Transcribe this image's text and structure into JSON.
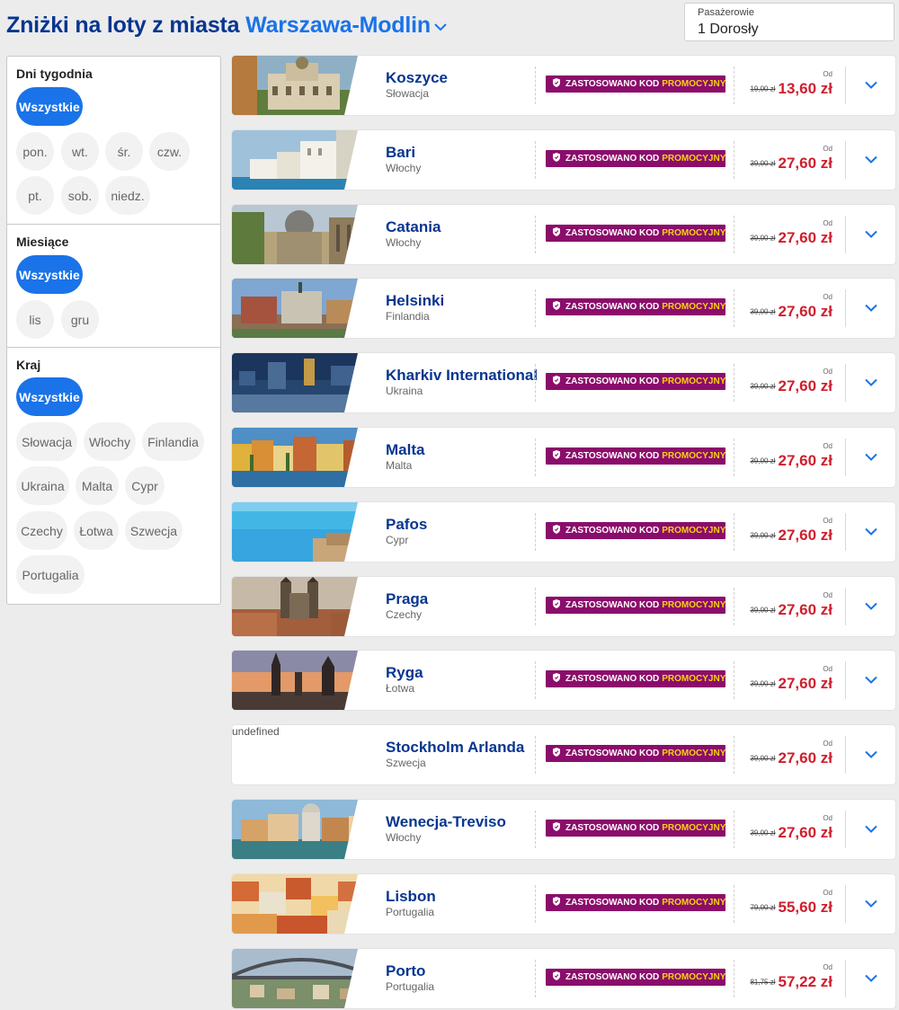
{
  "header": {
    "title_prefix": "Zniżki na loty z miasta",
    "city": "Warszawa-Modlin"
  },
  "passengers": {
    "label": "Pasażerowie",
    "value": "1 Dorosły"
  },
  "filters": {
    "days": {
      "title": "Dni tygodnia",
      "options": [
        "Wszystkie",
        "pon.",
        "wt.",
        "śr.",
        "czw.",
        "pt.",
        "sob.",
        "niedz."
      ],
      "selected": "Wszystkie"
    },
    "months": {
      "title": "Miesiące",
      "options": [
        "Wszystkie",
        "lis",
        "gru"
      ],
      "selected": "Wszystkie"
    },
    "country": {
      "title": "Kraj",
      "options": [
        "Wszystkie",
        "Słowacja",
        "Włochy",
        "Finlandia",
        "Ukraina",
        "Malta",
        "Cypr",
        "Czechy",
        "Łotwa",
        "Szwecja",
        "Portugalia"
      ],
      "selected": "Wszystkie"
    }
  },
  "promo": {
    "text": "ZASTOSOWANO KOD",
    "highlight": "PROMOCYJNY"
  },
  "price_prefix": "Od",
  "flights": [
    {
      "destination": "Koszyce",
      "country": "Słowacja",
      "old_price": "19,00 zł",
      "price": "13,60 zł",
      "image": "cathedral"
    },
    {
      "destination": "Bari",
      "country": "Włochy",
      "old_price": "39,00 zł",
      "price": "27,60 zł",
      "image": "coast-white"
    },
    {
      "destination": "Catania",
      "country": "Włochy",
      "old_price": "39,00 zł",
      "price": "27,60 zł",
      "image": "dome"
    },
    {
      "destination": "Helsinki",
      "country": "Finlandia",
      "old_price": "39,00 zł",
      "price": "27,60 zł",
      "image": "city-harbour"
    },
    {
      "destination": "Kharkiv International",
      "country": "Ukraina",
      "old_price": "39,00 zł",
      "price": "27,60 zł",
      "image": "night-city"
    },
    {
      "destination": "Malta",
      "country": "Malta",
      "old_price": "39,00 zł",
      "price": "27,60 zł",
      "image": "colourful-houses"
    },
    {
      "destination": "Pafos",
      "country": "Cypr",
      "old_price": "39,00 zł",
      "price": "27,60 zł",
      "image": "sea-cliff"
    },
    {
      "destination": "Praga",
      "country": "Czechy",
      "old_price": "39,00 zł",
      "price": "27,60 zł",
      "image": "towers"
    },
    {
      "destination": "Ryga",
      "country": "Łotwa",
      "old_price": "39,00 zł",
      "price": "27,60 zł",
      "image": "sunset-spires"
    },
    {
      "destination": "Stockholm Arlanda",
      "country": "Szwecja",
      "old_price": "39,00 zł",
      "price": "27,60 zł",
      "image": "broken",
      "image_alt": "undefined"
    },
    {
      "destination": "Wenecja-Treviso",
      "country": "Włochy",
      "old_price": "39,00 zł",
      "price": "27,60 zł",
      "image": "canal"
    },
    {
      "destination": "Lisbon",
      "country": "Portugalia",
      "old_price": "79,00 zł",
      "price": "55,60 zł",
      "image": "rooftops"
    },
    {
      "destination": "Porto",
      "country": "Portugalia",
      "old_price": "81,75 zł",
      "price": "57,22 zł",
      "image": "bridge"
    }
  ],
  "colors": {
    "navy": "#073590",
    "accent": "#1a73e8",
    "promo_bg": "#8b0d6b",
    "promo_highlight": "#f7d117",
    "price": "#cf1e2d"
  }
}
